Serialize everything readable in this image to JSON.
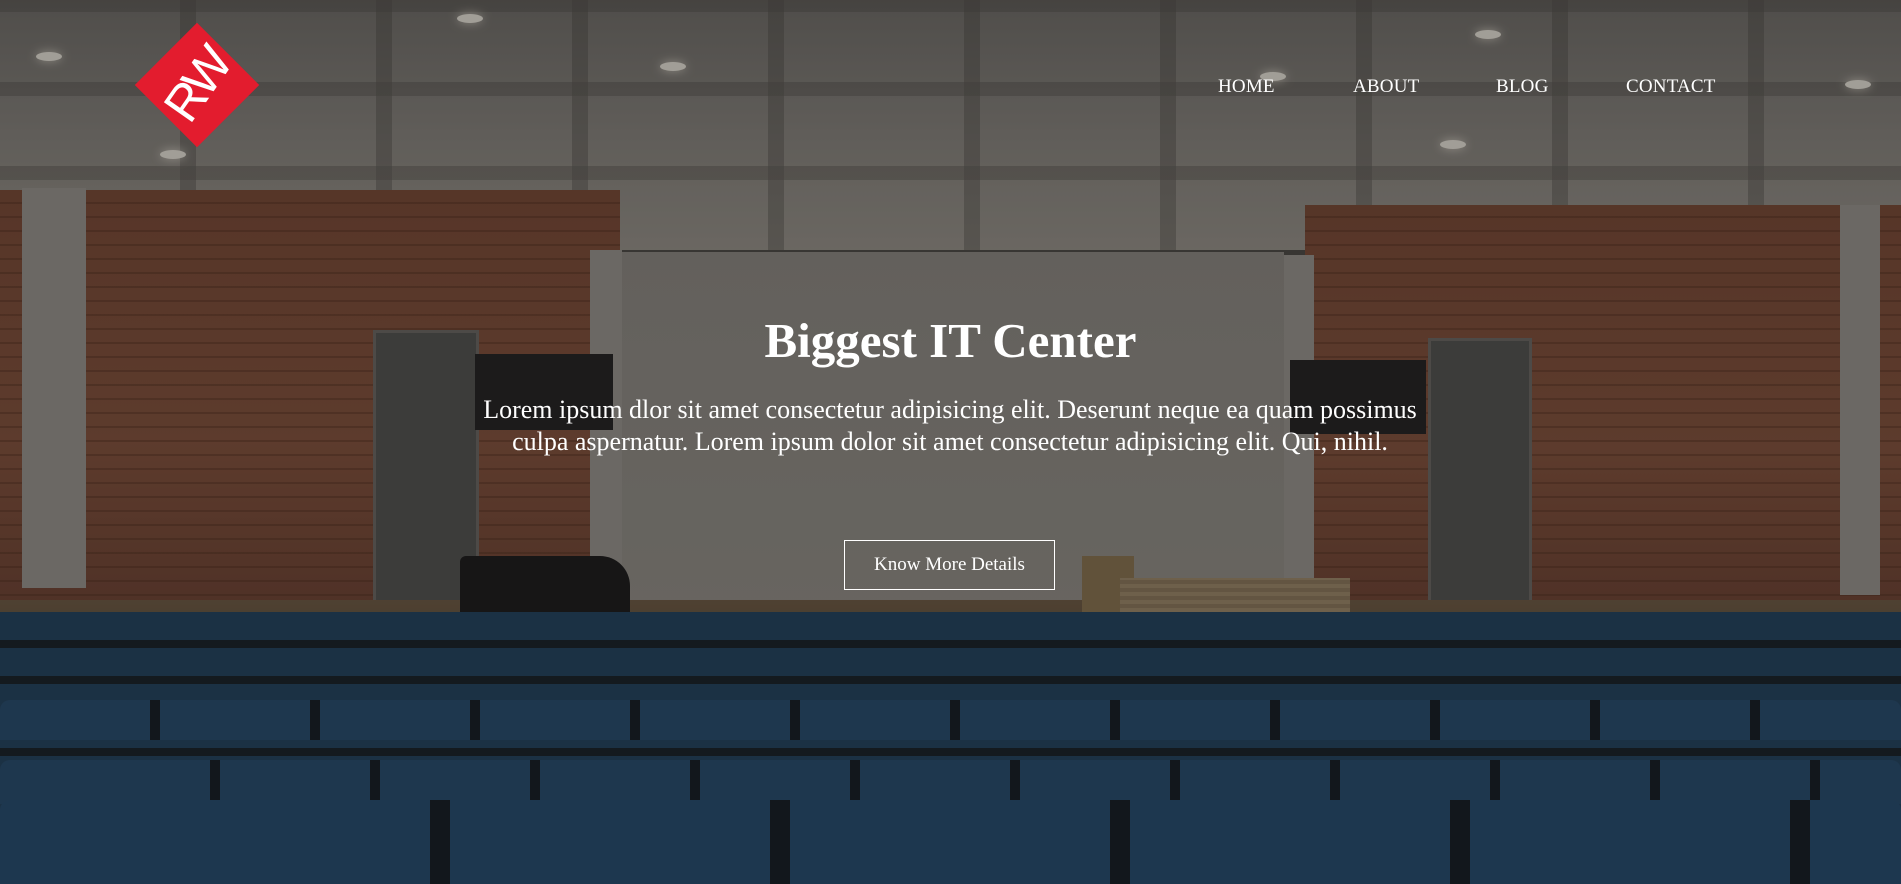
{
  "brand": {
    "logo_text": "RW",
    "logo_color": "#e31c2e"
  },
  "nav": {
    "items": [
      {
        "label": "HOME"
      },
      {
        "label": "ABOUT"
      },
      {
        "label": "BLOG"
      },
      {
        "label": "CONTACT"
      }
    ]
  },
  "hero": {
    "title": "Biggest IT Center",
    "description": "Lorem ipsum dlor sit amet consectetur adipisicing elit. Deserunt neque ea quam possimus culpa aspernatur. Lorem ipsum dolor sit amet consectetur adipisicing elit. Qui, nihil.",
    "cta_label": "Know More Details",
    "background_image": "lecture-hall-photo"
  }
}
